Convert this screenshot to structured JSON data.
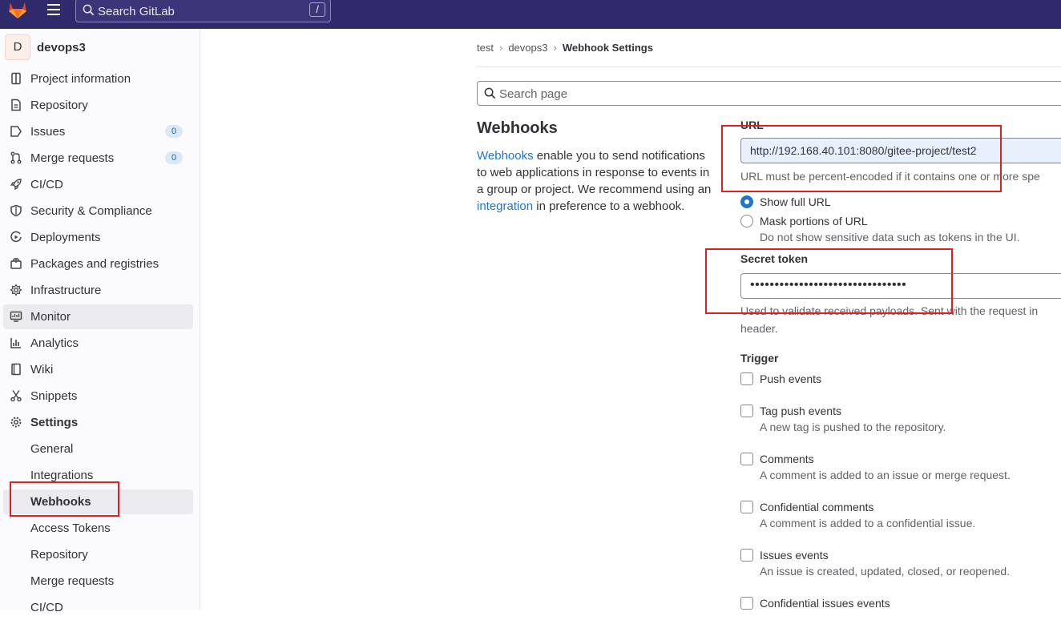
{
  "topbar": {
    "search_placeholder": "Search GitLab",
    "shortcut_key": "/"
  },
  "project": {
    "avatar_letter": "D",
    "name": "devops3"
  },
  "sidebar": {
    "items": [
      {
        "label": "Project information",
        "icon": "info-icon"
      },
      {
        "label": "Repository",
        "icon": "document-icon"
      },
      {
        "label": "Issues",
        "icon": "issues-icon",
        "badge": "0"
      },
      {
        "label": "Merge requests",
        "icon": "merge-request-icon",
        "badge": "0"
      },
      {
        "label": "CI/CD",
        "icon": "rocket-icon"
      },
      {
        "label": "Security & Compliance",
        "icon": "shield-icon"
      },
      {
        "label": "Deployments",
        "icon": "deployments-icon"
      },
      {
        "label": "Packages and registries",
        "icon": "package-icon"
      },
      {
        "label": "Infrastructure",
        "icon": "cloud-gear-icon"
      },
      {
        "label": "Monitor",
        "icon": "monitor-icon"
      },
      {
        "label": "Analytics",
        "icon": "chart-icon"
      },
      {
        "label": "Wiki",
        "icon": "book-icon"
      },
      {
        "label": "Snippets",
        "icon": "scissors-icon"
      },
      {
        "label": "Settings",
        "icon": "gear-icon"
      }
    ],
    "settings_sub": [
      "General",
      "Integrations",
      "Webhooks",
      "Access Tokens",
      "Repository",
      "Merge requests",
      "CI/CD"
    ]
  },
  "breadcrumb": [
    "test",
    "devops3",
    "Webhook Settings"
  ],
  "page_search_placeholder": "Search page",
  "main": {
    "title": "Webhooks",
    "desc_link1": "Webhooks",
    "desc_part1": " enable you to send notifications to web applications in response to events in a group or project. We recommend using an ",
    "desc_link2": "integration",
    "desc_part2": " in preference to a webhook."
  },
  "form": {
    "url_label": "URL",
    "url_value": "http://192.168.40.101:8080/gitee-project/test2",
    "url_help": "URL must be percent-encoded if it contains one or more spe",
    "radio_show": "Show full URL",
    "radio_mask": "Mask portions of URL",
    "radio_mask_help": "Do not show sensitive data such as tokens in the UI.",
    "secret_label": "Secret token",
    "secret_value": "••••••••••••••••••••••••••••••••",
    "secret_help1": "Used to validate received payloads. Sent with the request in",
    "secret_help2": "header.",
    "trigger_label": "Trigger",
    "triggers": [
      {
        "label": "Push events",
        "help": ""
      },
      {
        "label": "Tag push events",
        "help": "A new tag is pushed to the repository."
      },
      {
        "label": "Comments",
        "help": "A comment is added to an issue or merge request."
      },
      {
        "label": "Confidential comments",
        "help": "A comment is added to a confidential issue."
      },
      {
        "label": "Issues events",
        "help": "An issue is created, updated, closed, or reopened."
      },
      {
        "label": "Confidential issues events",
        "help": ""
      }
    ]
  },
  "colors": {
    "topbar": "#2f2a6b",
    "link": "#1f75cb",
    "annotation": "#e02020"
  }
}
